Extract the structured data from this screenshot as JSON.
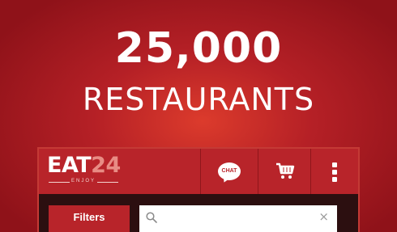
{
  "hero": {
    "number": "25,000",
    "text": "RESTAURANTS"
  },
  "app": {
    "logo": {
      "word": "EAT",
      "number": "24",
      "tagline": "ENJOY"
    },
    "chat_label": "CHAT",
    "filters_label": "Filters",
    "search": {
      "value": "",
      "placeholder": ""
    },
    "icons": {
      "chat": "chat-bubble-icon",
      "cart": "cart-icon",
      "menu": "overflow-menu-icon",
      "search": "search-icon",
      "clear": "close-icon"
    },
    "clear_glyph": "×"
  },
  "colors": {
    "brand_red": "#b8242a",
    "banner_center": "#dc3b2c",
    "banner_edge": "#8f1219",
    "logo_number": "#e88c84",
    "filter_bar": "#2c0f10"
  }
}
